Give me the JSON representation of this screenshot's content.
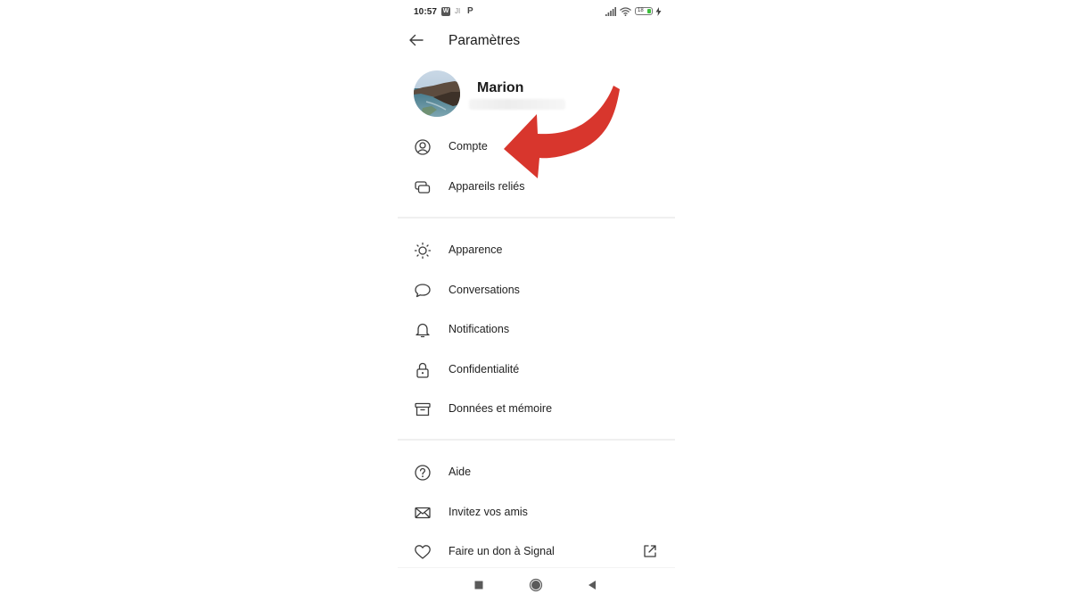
{
  "status_bar": {
    "time": "10:57",
    "app_icons": [
      "w-app-icon",
      "ji-icon",
      "p-app-icon"
    ],
    "w_label": "W",
    "ji_label": "JI",
    "p_label": "P",
    "battery_level": "18",
    "signal": "signal-icon",
    "wifi": "wifi-icon",
    "charging": "charging-icon"
  },
  "header": {
    "title": "Paramètres",
    "back_icon": "arrow-left-icon"
  },
  "profile": {
    "name": "Marion",
    "phone_number_blurred": true
  },
  "sections": [
    {
      "items": [
        {
          "label": "Compte",
          "icon": "account-icon"
        },
        {
          "label": "Appareils reliés",
          "icon": "linked-devices-icon"
        }
      ]
    },
    {
      "items": [
        {
          "label": "Apparence",
          "icon": "sun-icon"
        },
        {
          "label": "Conversations",
          "icon": "chat-bubble-icon"
        },
        {
          "label": "Notifications",
          "icon": "bell-icon"
        },
        {
          "label": "Confidentialité",
          "icon": "lock-icon"
        },
        {
          "label": "Données et mémoire",
          "icon": "archive-icon"
        }
      ]
    },
    {
      "items": [
        {
          "label": "Aide",
          "icon": "help-icon"
        },
        {
          "label": "Invitez vos amis",
          "icon": "envelope-icon"
        },
        {
          "label": "Faire un don à Signal",
          "icon": "heart-icon",
          "trailing_icon": "external-link-icon"
        }
      ]
    }
  ],
  "navbar": {
    "buttons": [
      "recents-button",
      "home-button",
      "back-button"
    ]
  },
  "annotation": {
    "type": "curved-arrow",
    "color": "#d8362d",
    "points_to": "Compte"
  },
  "colors": {
    "text": "#1b1b1b",
    "icon": "#3c3c3c",
    "divider": "#f0f0f0",
    "arrow": "#d8362d",
    "battery": "#3bbf3b"
  }
}
